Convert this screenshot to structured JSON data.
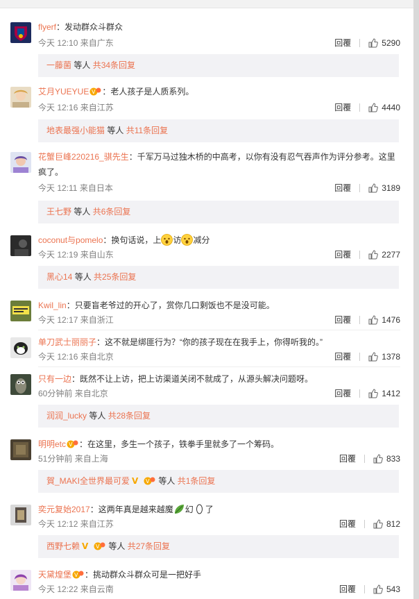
{
  "comments": [
    {
      "user": "flyerf",
      "colon": "：",
      "text": "发动群众斗群众",
      "time": "今天 12:10",
      "from": "来自广东",
      "reply_label": "回覆",
      "likes": "5290",
      "replies": {
        "first_user": "一藤菌",
        "mid": " 等人 ",
        "count_text": "共34条回复"
      }
    },
    {
      "user": "艾月YUEYUE",
      "colon": "：",
      "text": "老人孩子是人质系列。",
      "time": "今天 12:16",
      "from": "来自江苏",
      "reply_label": "回覆",
      "likes": "4440",
      "replies": {
        "first_user": "地表最强小能猫",
        "mid": " 等人 ",
        "count_text": "共11条回复"
      }
    },
    {
      "user": "花蟹巨峰220216_骐先生",
      "colon": "：",
      "text": "千军万马过独木桥的中高考，以你有没有忍气吞声作为评分参考。这里",
      "text2": "疯了。",
      "time": "今天 12:11",
      "from": "来自日本",
      "reply_label": "回覆",
      "likes": "3189",
      "replies": {
        "first_user": "王七野",
        "mid": " 等人 ",
        "count_text": "共6条回复"
      }
    },
    {
      "user": "coconut与pomelo",
      "colon": "：",
      "text_a": "换句话说，上",
      "text_b": "访",
      "text_c": "减分",
      "time": "今天 12:19",
      "from": "来自山东",
      "reply_label": "回覆",
      "likes": "2277",
      "replies": {
        "first_user": "黑心14",
        "mid": " 等人 ",
        "count_text": "共25条回复"
      }
    },
    {
      "user": "Kwil_lin",
      "colon": "：",
      "text": "只要盲老爷过的开心了，赏你几口剩饭也不是没可能。",
      "time": "今天 12:17",
      "from": "来自浙江",
      "reply_label": "回覆",
      "likes": "1476"
    },
    {
      "user": "单刀武士丽丽子",
      "colon": "：",
      "text": "这不就是绑匪行为？“你的孩子现在在我手上，你得听我的。”",
      "time": "今天 12:16",
      "from": "来自北京",
      "reply_label": "回覆",
      "likes": "1378"
    },
    {
      "user": "只有一边",
      "colon": "：",
      "text": "既然不让上访，把上访渠道关闭不就成了，从源头解决问题呀。",
      "time": "60分钟前",
      "from": "来自北京",
      "reply_label": "回覆",
      "likes": "1412",
      "replies": {
        "first_user": "润润_lucky",
        "mid": " 等人 ",
        "count_text": "共28条回复"
      }
    },
    {
      "user": "明明etc",
      "colon": "：",
      "text": "在这里，多生一个孩子，铁拳手里就多了一个筹码。",
      "time": "51分钟前",
      "from": "来自上海",
      "reply_label": "回覆",
      "likes": "833",
      "replies": {
        "first_user": "賀_MAKI全世界最可爱",
        "mid": " 等人 ",
        "count_text": "共1条回复"
      }
    },
    {
      "user": "奕元复始2017",
      "colon": "：",
      "text_a": "这两年真是越来越魔",
      "text_b": "幻",
      "text_c": "了",
      "time": "今天 12:12",
      "from": "来自江苏",
      "reply_label": "回覆",
      "likes": "812",
      "replies": {
        "first_user": "西野七赖",
        "mid": " 等人 ",
        "count_text": "共27条回复"
      }
    },
    {
      "user": "天黛煌堡",
      "colon": "：",
      "text": "挑动群众斗群众可是一把好手",
      "time": "今天 12:22",
      "from": "来自云南",
      "reply_label": "回覆",
      "likes": "543"
    }
  ],
  "colors": {
    "username": "#eb7350",
    "meta": "#808080",
    "reply_box_bg": "#f2f2f5"
  }
}
